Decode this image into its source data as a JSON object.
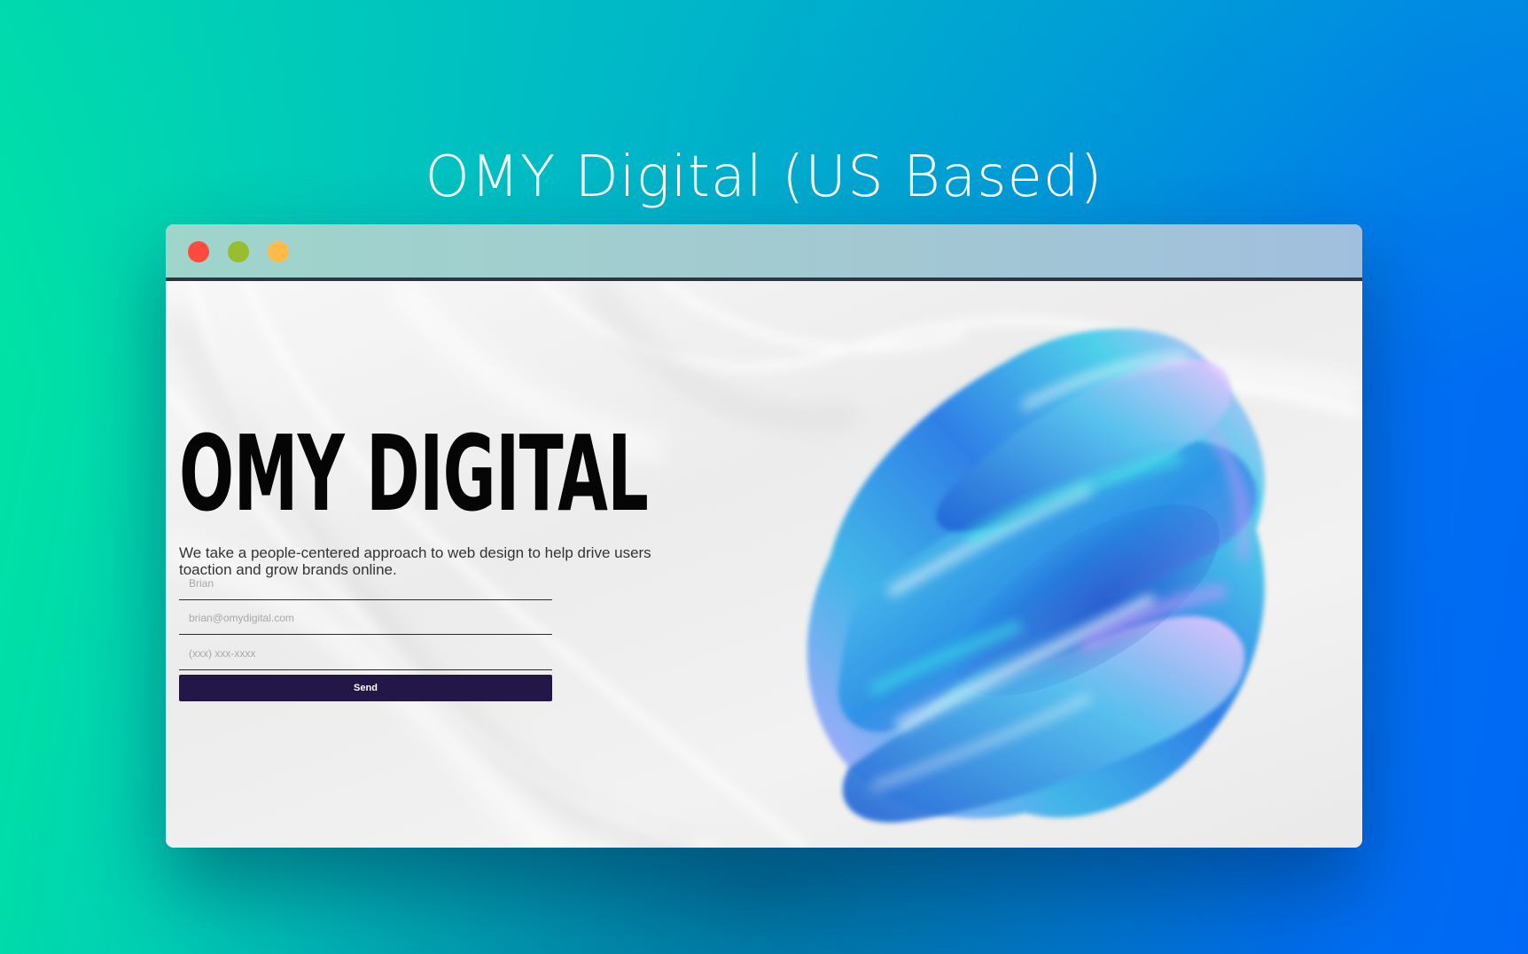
{
  "page": {
    "title": "OMY Digital (US Based)"
  },
  "window": {
    "controls": [
      "close",
      "minimize",
      "maximize"
    ],
    "colors": {
      "close": "#ff4b3e",
      "minimize": "#96be2e",
      "maximize": "#ffba4a"
    }
  },
  "hero": {
    "title": "OMY DIGITAL",
    "description": "We take a people-centered approach to web design to help drive users toaction and grow brands online."
  },
  "form": {
    "name_placeholder": "Brian",
    "email_placeholder": "brian@omydigital.com",
    "phone_placeholder": "(xxx) xxx-xxxx",
    "send_label": "Send"
  },
  "colors": {
    "button": "#231747",
    "background_start": "#00e8a0",
    "background_end": "#0068f5"
  }
}
